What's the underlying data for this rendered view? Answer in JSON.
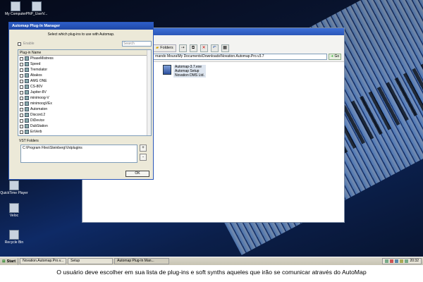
{
  "desktop": {
    "icons": [
      {
        "label": "My Computer"
      },
      {
        "label": "PNP_UserV..."
      },
      {
        "label": "QuickTime Player"
      },
      {
        "label": "Veloc"
      },
      {
        "label": "Recycle Bin"
      }
    ]
  },
  "explorer": {
    "toolbar": {
      "folders_label": "Folders"
    },
    "address": "rnando Moura\\My Documents\\Downloads\\Novation.Automap.Pro.v3.7",
    "go_label": "Go",
    "file": {
      "line1": "Automap-3.7.exe",
      "line2": "Automap Setup",
      "line3": "Novation DMS Ltd."
    }
  },
  "plugin_manager": {
    "title": "Automap Plug-In Manager",
    "instruction": "Select which plug-ins to use with Automap.",
    "enable_label": "Enable",
    "search_placeholder": "Search",
    "list_header": "Plug-in Name",
    "plugins": [
      "PhaseMistress",
      "Speed",
      "Tremolator",
      "Abakos",
      "AMG ONE",
      "CS-80V",
      "Jupiter-8V",
      "minimoog-V",
      "minimoogVEx",
      "Automaton",
      "Discord.2",
      "DiDevice",
      "DubStation",
      "EnVerb",
      "Replicant"
    ],
    "vst_label": "VST Folders",
    "vst_path": "C:\\Program Files\\Steinberg\\Vstplugins",
    "add_label": "+",
    "remove_label": "-",
    "ok_label": "OK"
  },
  "taskbar": {
    "start_label": "Start",
    "tasks": [
      "Novation.Automap.Pro.v...",
      "Setup",
      "Automap Plug-In Man..."
    ],
    "clock": "20:32"
  },
  "caption": "O usuário deve escolher em sua lista de plug-ins e soft synths aqueles que irão se comunicar através do AutoMap"
}
